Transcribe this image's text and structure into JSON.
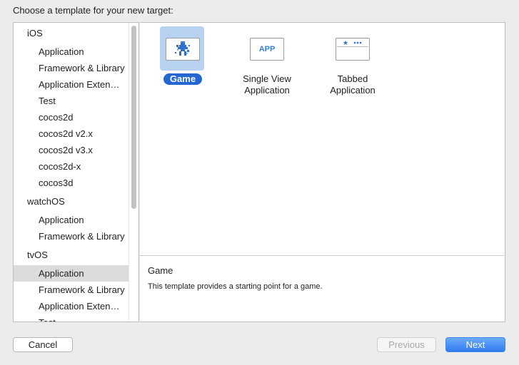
{
  "heading": "Choose a template for your new target:",
  "sidebar": {
    "groups": [
      {
        "label": "iOS",
        "items": [
          "Application",
          "Framework & Library",
          "Application Exten…",
          "Test",
          "cocos2d",
          "cocos2d v2.x",
          "cocos2d v3.x",
          "cocos2d-x",
          "cocos3d"
        ]
      },
      {
        "label": "watchOS",
        "items": [
          "Application",
          "Framework & Library"
        ]
      },
      {
        "label": "tvOS",
        "items": [
          "Application",
          "Framework & Library",
          "Application Exten…",
          "Test"
        ]
      }
    ],
    "selected": "tvOS / Application"
  },
  "templates": [
    {
      "label": "Game",
      "icon": "game-sprite-icon",
      "selected": true
    },
    {
      "label": "Single View Application",
      "icon": "app-icon",
      "icon_text": "APP",
      "selected": false
    },
    {
      "label": "Tabbed Application",
      "icon": "tabbed-icon",
      "selected": false
    }
  ],
  "description": {
    "title": "Game",
    "text": "This template provides a starting point for a game."
  },
  "buttons": {
    "cancel": "Cancel",
    "previous": "Previous",
    "next": "Next"
  },
  "colors": {
    "accent": "#2466d2",
    "selection_bg": "#b7d1f1",
    "sidebar_selected": "#dcdcdc"
  }
}
